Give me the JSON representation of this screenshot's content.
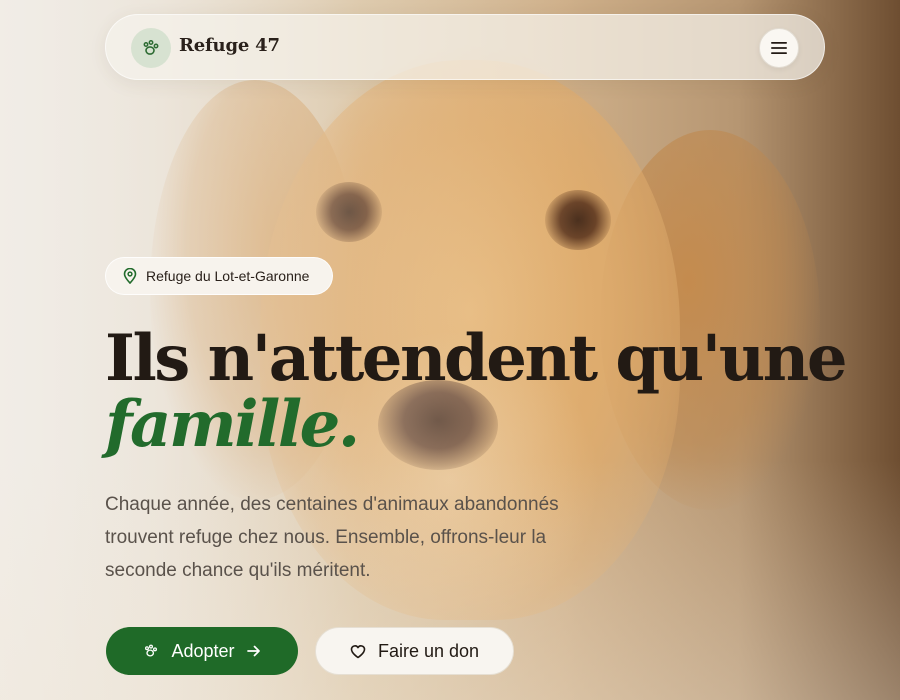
{
  "nav": {
    "brand": "Refuge 47",
    "logo_icon": "paw-icon",
    "menu_icon": "hamburger-icon"
  },
  "hero": {
    "location_icon": "map-pin-icon",
    "location": "Refuge du Lot-et-Garonne",
    "headline_line1": "Ils n'attendent qu'une",
    "headline_accent": "famille.",
    "lead": "Chaque année, des centaines d'animaux abandonnés trouvent refuge chez nous. Ensemble, offrons-leur la seconde chance qu'ils méritent."
  },
  "actions": {
    "adopt_label": "Adopter",
    "adopt_icon": "paw-icon",
    "adopt_arrow_icon": "arrow-right-icon",
    "donate_label": "Faire un don",
    "donate_icon": "heart-icon"
  },
  "colors": {
    "accent_green": "#226b2c",
    "button_green": "#1f6a28",
    "text_dark": "#221a14",
    "text_muted": "#5a524b"
  }
}
